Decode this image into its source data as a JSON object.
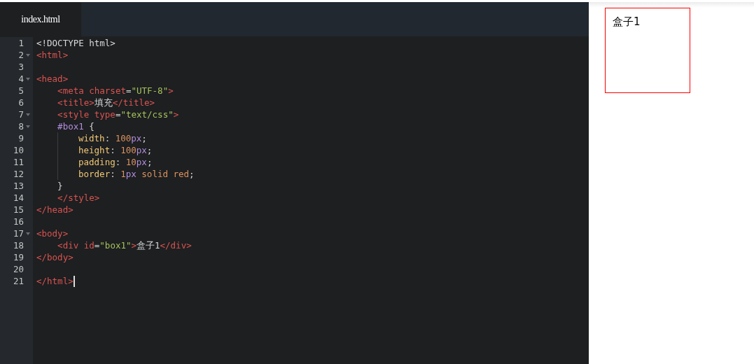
{
  "tabs": [
    {
      "label": "index.html",
      "selected": true
    }
  ],
  "lines": [
    {
      "number": "1",
      "foldable": false,
      "tokens": [
        {
          "kind": "plain",
          "text": "<!DOCTYPE html>"
        }
      ]
    },
    {
      "number": "2",
      "foldable": true,
      "tokens": [
        {
          "kind": "tag",
          "text": "<html>"
        }
      ]
    },
    {
      "number": "3",
      "foldable": false
    },
    {
      "number": "4",
      "foldable": true,
      "tokens": [
        {
          "kind": "tag",
          "text": "<head>"
        }
      ]
    },
    {
      "number": "5",
      "foldable": false,
      "tokens": [
        {
          "kind": "tag",
          "text": "    <meta"
        },
        {
          "kind": "attr",
          "text": " charset"
        },
        {
          "kind": "plain",
          "text": "="
        },
        {
          "kind": "string",
          "text": "\"UTF-8\""
        },
        {
          "kind": "tag",
          "text": ">"
        }
      ]
    },
    {
      "number": "6",
      "foldable": false,
      "tokens": [
        {
          "kind": "tag",
          "text": "    <title>"
        },
        {
          "kind": "plain",
          "text": "填充"
        },
        {
          "kind": "tag",
          "text": "</title>"
        }
      ]
    },
    {
      "number": "7",
      "foldable": true,
      "tokens": [
        {
          "kind": "tag",
          "text": "    <style"
        },
        {
          "kind": "attr",
          "text": " type"
        },
        {
          "kind": "plain",
          "text": "="
        },
        {
          "kind": "string",
          "text": "\"text/css\""
        },
        {
          "kind": "tag",
          "text": ">"
        }
      ]
    },
    {
      "number": "8",
      "foldable": true,
      "tokens": [
        {
          "kind": "selector",
          "text": "    #box1"
        },
        {
          "kind": "plain",
          "text": " {"
        }
      ]
    },
    {
      "number": "9",
      "foldable": false,
      "guide": true,
      "tokens": [
        {
          "kind": "prop",
          "text": "width"
        },
        {
          "kind": "plain",
          "text": ": "
        },
        {
          "kind": "number",
          "text": "100"
        },
        {
          "kind": "unit",
          "text": "px"
        },
        {
          "kind": "plain",
          "text": ";"
        }
      ]
    },
    {
      "number": "10",
      "foldable": false,
      "guide": true,
      "tokens": [
        {
          "kind": "prop",
          "text": "height"
        },
        {
          "kind": "plain",
          "text": ": "
        },
        {
          "kind": "number",
          "text": "100"
        },
        {
          "kind": "unit",
          "text": "px"
        },
        {
          "kind": "plain",
          "text": ";"
        }
      ]
    },
    {
      "number": "11",
      "foldable": false,
      "guide": true,
      "tokens": [
        {
          "kind": "prop",
          "text": "padding"
        },
        {
          "kind": "plain",
          "text": ": "
        },
        {
          "kind": "number",
          "text": "10"
        },
        {
          "kind": "unit",
          "text": "px"
        },
        {
          "kind": "plain",
          "text": ";"
        }
      ]
    },
    {
      "number": "12",
      "foldable": false,
      "guide": true,
      "tokens": [
        {
          "kind": "prop",
          "text": "border"
        },
        {
          "kind": "plain",
          "text": ": "
        },
        {
          "kind": "number",
          "text": "1"
        },
        {
          "kind": "unit",
          "text": "px"
        },
        {
          "kind": "value",
          "text": " solid red"
        },
        {
          "kind": "plain",
          "text": ";"
        }
      ]
    },
    {
      "number": "13",
      "foldable": false,
      "tokens": [
        {
          "kind": "plain",
          "text": "    }"
        }
      ]
    },
    {
      "number": "14",
      "foldable": false,
      "tokens": [
        {
          "kind": "tag",
          "text": "    </style>"
        }
      ]
    },
    {
      "number": "15",
      "foldable": false,
      "tokens": [
        {
          "kind": "tag",
          "text": "</head>"
        }
      ]
    },
    {
      "number": "16",
      "foldable": false
    },
    {
      "number": "17",
      "foldable": true,
      "tokens": [
        {
          "kind": "tag",
          "text": "<body>"
        }
      ]
    },
    {
      "number": "18",
      "foldable": false,
      "tokens": [
        {
          "kind": "tag",
          "text": "    <div"
        },
        {
          "kind": "attr",
          "text": " id"
        },
        {
          "kind": "plain",
          "text": "="
        },
        {
          "kind": "string",
          "text": "\"box1\""
        },
        {
          "kind": "tag",
          "text": ">"
        },
        {
          "kind": "plain",
          "text": "盒子1"
        },
        {
          "kind": "tag",
          "text": "</div>"
        }
      ]
    },
    {
      "number": "19",
      "foldable": false,
      "tokens": [
        {
          "kind": "tag",
          "text": "</body>"
        }
      ]
    },
    {
      "number": "20",
      "foldable": false
    },
    {
      "number": "21",
      "foldable": false,
      "cursor": true,
      "tokens": [
        {
          "kind": "tag",
          "text": "</html>"
        }
      ]
    }
  ],
  "preview": {
    "box_text": "盒子1"
  }
}
